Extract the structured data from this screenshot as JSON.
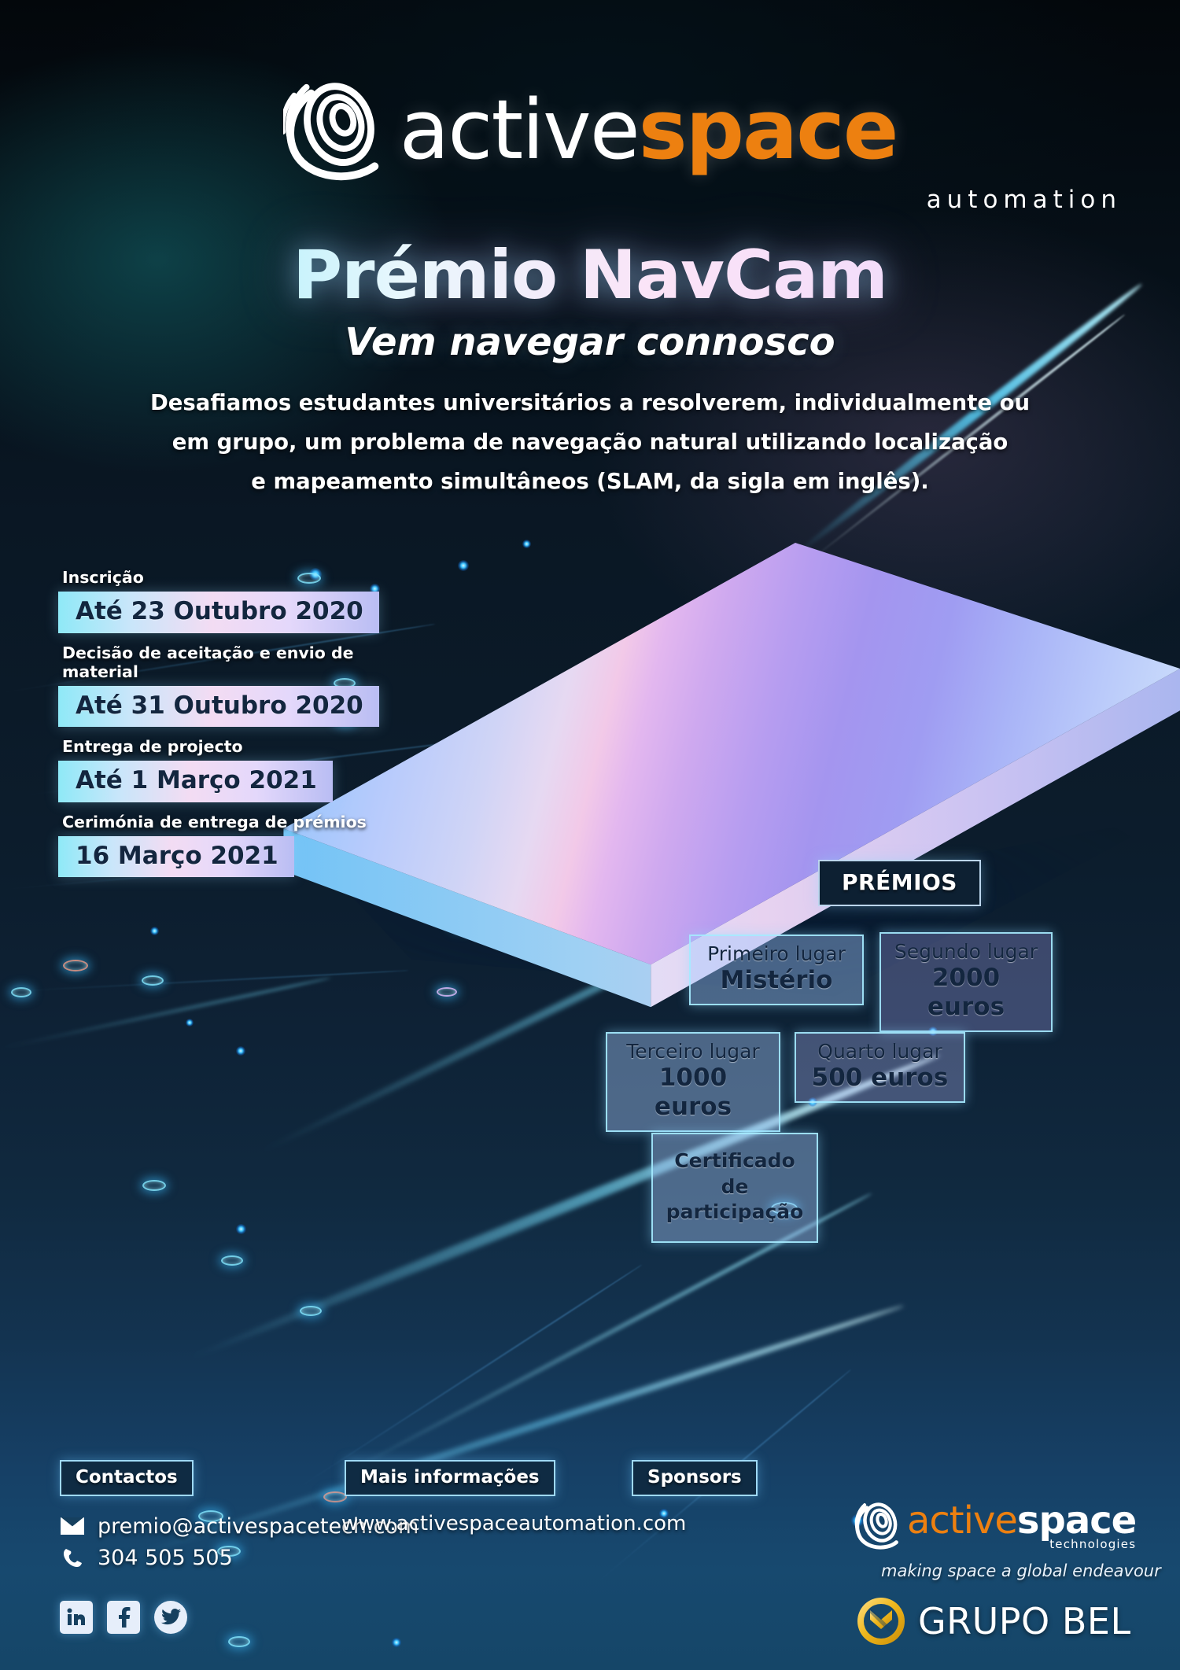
{
  "brand": {
    "logo_word_light": "active",
    "logo_word_bold": "space",
    "logo_sub": "automation",
    "orange": "#ED8010"
  },
  "title": "Prémio NavCam",
  "subtitle": "Vem navegar connosco",
  "intro": {
    "line1": "Desafiamos estudantes universitários a resolverem, individualmente ou",
    "line2": "em grupo, um problema de navegação natural utilizando localização",
    "line3": "e mapeamento simultâneos (SLAM, da sigla em inglês)."
  },
  "schedule": [
    {
      "label": "Inscrição",
      "date": "Até 23 Outubro 2020"
    },
    {
      "label": "Decisão de aceitação e envio de material",
      "date": "Até 31 Outubro 2020"
    },
    {
      "label": "Entrega de projecto",
      "date": "Até 1 Março 2021"
    },
    {
      "label": "Cerimónia de entrega de prémios",
      "date": "16 Março 2021"
    }
  ],
  "prizes": {
    "heading": "PRÉMIOS",
    "items": [
      {
        "place": "Primeiro lugar",
        "value": "Mistério"
      },
      {
        "place": "Segundo lugar",
        "value": "2000 euros"
      },
      {
        "place": "Terceiro lugar",
        "value": "1000 euros"
      },
      {
        "place": "Quarto lugar",
        "value": "500 euros"
      }
    ],
    "certificate_line1": "Certificado de",
    "certificate_line2": "participação"
  },
  "footer": {
    "contacts_heading": "Contactos",
    "email": "premio@activespacetech.com",
    "phone": "304 505 505",
    "info_heading": "Mais informações",
    "website": "www.activespaceautomation.com",
    "sponsors_heading": "Sponsors",
    "sponsor1_light": "active",
    "sponsor1_bold": "space",
    "sponsor1_sub": "technologies",
    "sponsor1_tagline": "making space a global endeavour",
    "sponsor2": "GRUPO BEL",
    "social": [
      "linkedin-icon",
      "facebook-icon",
      "twitter-icon"
    ]
  }
}
